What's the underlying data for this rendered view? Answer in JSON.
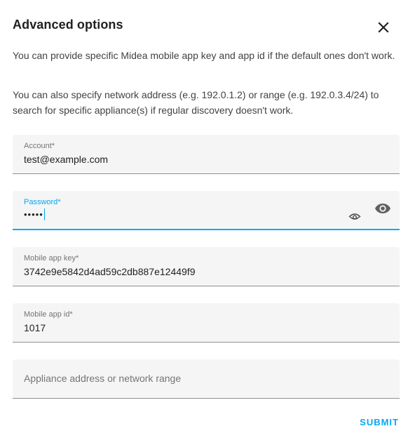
{
  "dialog": {
    "title": "Advanced options",
    "description_1": "You can provide specific Midea mobile app key and app id if the default ones don't work.",
    "description_2": "You can also specify network address (e.g. 192.0.1.2) or range (e.g. 192.0.3.4/24) to search for specific appliance(s) if regular discovery doesn't work."
  },
  "fields": {
    "account": {
      "label": "Account*",
      "value": "test@example.com"
    },
    "password": {
      "label": "Password*",
      "value": "•••••"
    },
    "app_key": {
      "label": "Mobile app key*",
      "value": "3742e9e5842d4ad59c2db887e12449f9"
    },
    "app_id": {
      "label": "Mobile app id*",
      "value": "1017"
    },
    "address": {
      "placeholder": "Appliance address or network range"
    }
  },
  "actions": {
    "submit_label": "SUBMIT"
  },
  "colors": {
    "accent": "#03a9f4",
    "field_bg": "#f5f5f5",
    "text": "#212121",
    "label": "#757575"
  },
  "icons": {
    "close": "close-icon",
    "reveal_small": "eye-outline-icon",
    "reveal": "eye-icon"
  }
}
